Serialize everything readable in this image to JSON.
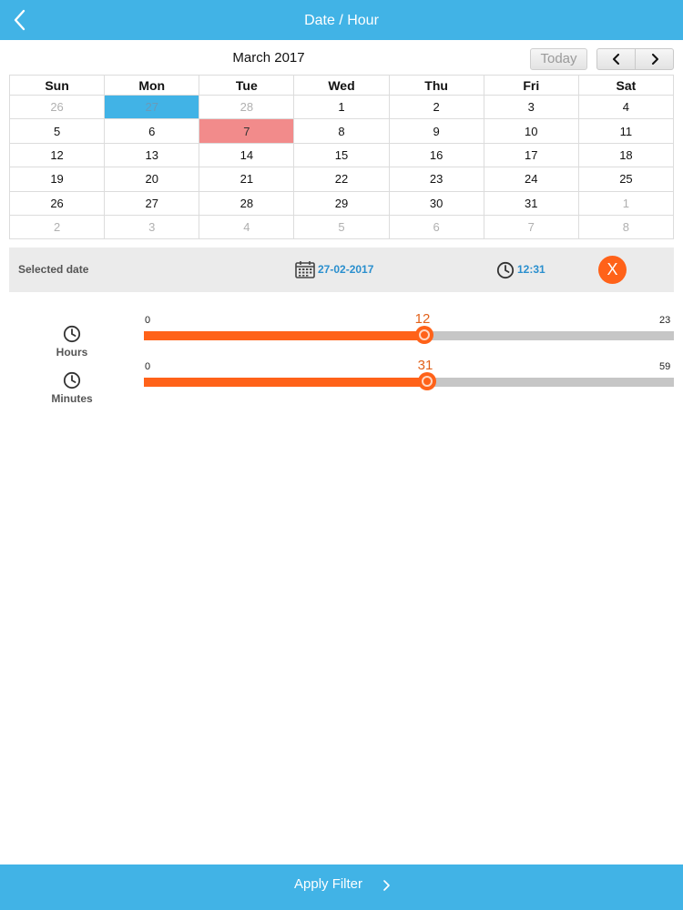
{
  "header": {
    "title": "Date / Hour",
    "back_icon": "chevron-left-icon",
    "bar_color": "#41b3e6"
  },
  "calendar": {
    "month_title": "March 2017",
    "today_label": "Today",
    "prev_icon": "chevron-left-icon",
    "next_icon": "chevron-right-icon",
    "weekdays": [
      "Sun",
      "Mon",
      "Tue",
      "Wed",
      "Thu",
      "Fri",
      "Sat"
    ],
    "weeks": [
      [
        "26",
        "27",
        "28",
        "1",
        "2",
        "3",
        "4"
      ],
      [
        "5",
        "6",
        "7",
        "8",
        "9",
        "10",
        "11"
      ],
      [
        "12",
        "13",
        "14",
        "15",
        "16",
        "17",
        "18"
      ],
      [
        "19",
        "20",
        "21",
        "22",
        "23",
        "24",
        "25"
      ],
      [
        "26",
        "27",
        "28",
        "29",
        "30",
        "31",
        "1"
      ],
      [
        "2",
        "3",
        "4",
        "5",
        "6",
        "7",
        "8"
      ]
    ],
    "selected_color": "#41b3e6",
    "today_color": "#f28b8b"
  },
  "selection": {
    "label": "Selected date",
    "date": "27-02-2017",
    "time": "12:31",
    "clear_label": "X",
    "clear_color": "#ff6219"
  },
  "sliders": {
    "hours": {
      "label": "Hours",
      "min": "0",
      "max": "23",
      "value": "12",
      "fraction": 0.53
    },
    "minutes": {
      "label": "Minutes",
      "min": "0",
      "max": "59",
      "value": "31",
      "fraction": 0.535
    },
    "accent_color": "#ff6219"
  },
  "footer": {
    "apply_label": "Apply Filter",
    "chevron_icon": "chevron-right-icon"
  }
}
